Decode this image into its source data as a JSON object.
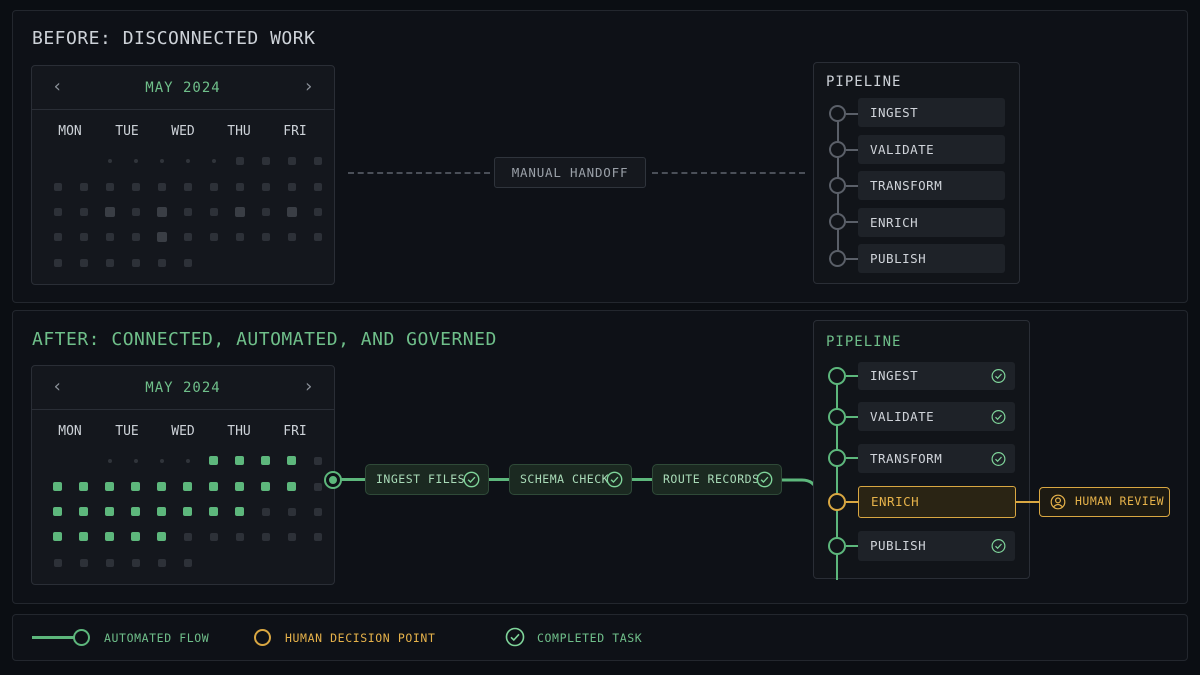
{
  "before": {
    "title": "BEFORE: DISCONNECTED WORK",
    "calendar": {
      "month": "MAY 2024",
      "prev_icon": "chevron-left-icon",
      "next_icon": "chevron-right-icon",
      "days": [
        "MON",
        "TUE",
        "WED",
        "THU",
        "FRI"
      ]
    },
    "handoff_label": "MANUAL HANDOFF",
    "pipeline": {
      "title": "PIPELINE",
      "stages": [
        "INGEST",
        "VALIDATE",
        "TRANSFORM",
        "ENRICH",
        "PUBLISH"
      ]
    }
  },
  "after": {
    "title": "AFTER: CONNECTED, AUTOMATED, AND GOVERNED",
    "calendar": {
      "month": "MAY 2024",
      "prev_icon": "chevron-left-icon",
      "next_icon": "chevron-right-icon",
      "days": [
        "MON",
        "TUE",
        "WED",
        "THU",
        "FRI"
      ]
    },
    "tasks": [
      {
        "label": "INGEST FILES",
        "status": "completed"
      },
      {
        "label": "SCHEMA CHECK",
        "status": "completed"
      },
      {
        "label": "ROUTE RECORDS",
        "status": "completed"
      }
    ],
    "pipeline": {
      "title": "PIPELINE",
      "stages": [
        {
          "label": "INGEST",
          "status": "completed"
        },
        {
          "label": "VALIDATE",
          "status": "completed"
        },
        {
          "label": "TRANSFORM",
          "status": "completed"
        },
        {
          "label": "ENRICH",
          "status": "human-decision"
        },
        {
          "label": "PUBLISH",
          "status": "completed"
        }
      ]
    },
    "human_review_label": "HUMAN REVIEW"
  },
  "legend": {
    "automated_flow": "AUTOMATED FLOW",
    "human_decision_point": "HUMAN DECISION POINT",
    "completed_task": "COMPLETED TASK"
  },
  "colors": {
    "green": "#5db77c",
    "amber": "#d9a742",
    "gray_node": "#5a5f68",
    "panel": "#0e1117"
  }
}
